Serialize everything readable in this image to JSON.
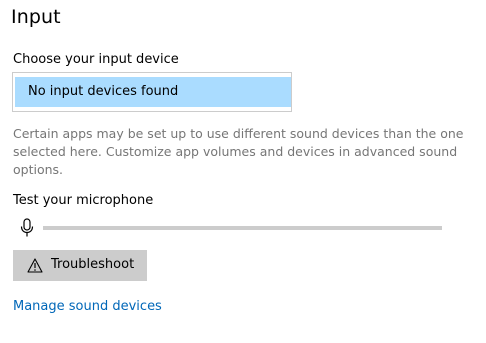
{
  "section": {
    "title": "Input"
  },
  "input_device": {
    "label": "Choose your input device",
    "selected_value": "No input devices found"
  },
  "description": "Certain apps may be set up to use different sound devices than the one selected here. Customize app volumes and devices in advanced sound options.",
  "microphone_test": {
    "label": "Test your microphone",
    "level_fraction": 0
  },
  "troubleshoot": {
    "label": "Troubleshoot",
    "icon": "warning-icon"
  },
  "manage_link": {
    "label": "Manage sound devices"
  },
  "colors": {
    "selection": "#aadcff",
    "link": "#0067b8",
    "button_bg": "#cccccc",
    "track": "#cccccc",
    "muted_text": "#767676"
  }
}
